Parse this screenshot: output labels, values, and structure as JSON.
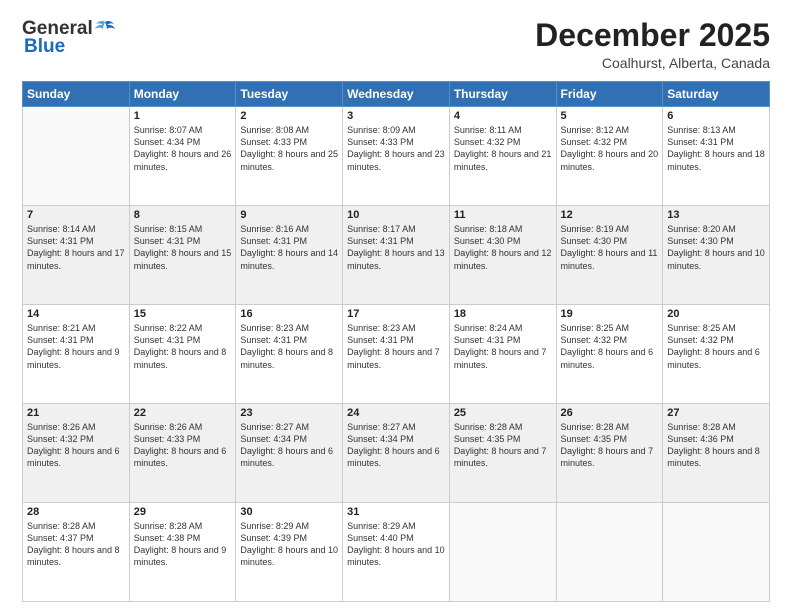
{
  "logo": {
    "general": "General",
    "blue": "Blue"
  },
  "header": {
    "month": "December 2025",
    "location": "Coalhurst, Alberta, Canada"
  },
  "weekdays": [
    "Sunday",
    "Monday",
    "Tuesday",
    "Wednesday",
    "Thursday",
    "Friday",
    "Saturday"
  ],
  "weeks": [
    [
      {
        "day": "",
        "sunrise": "",
        "sunset": "",
        "daylight": ""
      },
      {
        "day": "1",
        "sunrise": "Sunrise: 8:07 AM",
        "sunset": "Sunset: 4:34 PM",
        "daylight": "Daylight: 8 hours and 26 minutes."
      },
      {
        "day": "2",
        "sunrise": "Sunrise: 8:08 AM",
        "sunset": "Sunset: 4:33 PM",
        "daylight": "Daylight: 8 hours and 25 minutes."
      },
      {
        "day": "3",
        "sunrise": "Sunrise: 8:09 AM",
        "sunset": "Sunset: 4:33 PM",
        "daylight": "Daylight: 8 hours and 23 minutes."
      },
      {
        "day": "4",
        "sunrise": "Sunrise: 8:11 AM",
        "sunset": "Sunset: 4:32 PM",
        "daylight": "Daylight: 8 hours and 21 minutes."
      },
      {
        "day": "5",
        "sunrise": "Sunrise: 8:12 AM",
        "sunset": "Sunset: 4:32 PM",
        "daylight": "Daylight: 8 hours and 20 minutes."
      },
      {
        "day": "6",
        "sunrise": "Sunrise: 8:13 AM",
        "sunset": "Sunset: 4:31 PM",
        "daylight": "Daylight: 8 hours and 18 minutes."
      }
    ],
    [
      {
        "day": "7",
        "sunrise": "Sunrise: 8:14 AM",
        "sunset": "Sunset: 4:31 PM",
        "daylight": "Daylight: 8 hours and 17 minutes."
      },
      {
        "day": "8",
        "sunrise": "Sunrise: 8:15 AM",
        "sunset": "Sunset: 4:31 PM",
        "daylight": "Daylight: 8 hours and 15 minutes."
      },
      {
        "day": "9",
        "sunrise": "Sunrise: 8:16 AM",
        "sunset": "Sunset: 4:31 PM",
        "daylight": "Daylight: 8 hours and 14 minutes."
      },
      {
        "day": "10",
        "sunrise": "Sunrise: 8:17 AM",
        "sunset": "Sunset: 4:31 PM",
        "daylight": "Daylight: 8 hours and 13 minutes."
      },
      {
        "day": "11",
        "sunrise": "Sunrise: 8:18 AM",
        "sunset": "Sunset: 4:30 PM",
        "daylight": "Daylight: 8 hours and 12 minutes."
      },
      {
        "day": "12",
        "sunrise": "Sunrise: 8:19 AM",
        "sunset": "Sunset: 4:30 PM",
        "daylight": "Daylight: 8 hours and 11 minutes."
      },
      {
        "day": "13",
        "sunrise": "Sunrise: 8:20 AM",
        "sunset": "Sunset: 4:30 PM",
        "daylight": "Daylight: 8 hours and 10 minutes."
      }
    ],
    [
      {
        "day": "14",
        "sunrise": "Sunrise: 8:21 AM",
        "sunset": "Sunset: 4:31 PM",
        "daylight": "Daylight: 8 hours and 9 minutes."
      },
      {
        "day": "15",
        "sunrise": "Sunrise: 8:22 AM",
        "sunset": "Sunset: 4:31 PM",
        "daylight": "Daylight: 8 hours and 8 minutes."
      },
      {
        "day": "16",
        "sunrise": "Sunrise: 8:23 AM",
        "sunset": "Sunset: 4:31 PM",
        "daylight": "Daylight: 8 hours and 8 minutes."
      },
      {
        "day": "17",
        "sunrise": "Sunrise: 8:23 AM",
        "sunset": "Sunset: 4:31 PM",
        "daylight": "Daylight: 8 hours and 7 minutes."
      },
      {
        "day": "18",
        "sunrise": "Sunrise: 8:24 AM",
        "sunset": "Sunset: 4:31 PM",
        "daylight": "Daylight: 8 hours and 7 minutes."
      },
      {
        "day": "19",
        "sunrise": "Sunrise: 8:25 AM",
        "sunset": "Sunset: 4:32 PM",
        "daylight": "Daylight: 8 hours and 6 minutes."
      },
      {
        "day": "20",
        "sunrise": "Sunrise: 8:25 AM",
        "sunset": "Sunset: 4:32 PM",
        "daylight": "Daylight: 8 hours and 6 minutes."
      }
    ],
    [
      {
        "day": "21",
        "sunrise": "Sunrise: 8:26 AM",
        "sunset": "Sunset: 4:32 PM",
        "daylight": "Daylight: 8 hours and 6 minutes."
      },
      {
        "day": "22",
        "sunrise": "Sunrise: 8:26 AM",
        "sunset": "Sunset: 4:33 PM",
        "daylight": "Daylight: 8 hours and 6 minutes."
      },
      {
        "day": "23",
        "sunrise": "Sunrise: 8:27 AM",
        "sunset": "Sunset: 4:34 PM",
        "daylight": "Daylight: 8 hours and 6 minutes."
      },
      {
        "day": "24",
        "sunrise": "Sunrise: 8:27 AM",
        "sunset": "Sunset: 4:34 PM",
        "daylight": "Daylight: 8 hours and 6 minutes."
      },
      {
        "day": "25",
        "sunrise": "Sunrise: 8:28 AM",
        "sunset": "Sunset: 4:35 PM",
        "daylight": "Daylight: 8 hours and 7 minutes."
      },
      {
        "day": "26",
        "sunrise": "Sunrise: 8:28 AM",
        "sunset": "Sunset: 4:35 PM",
        "daylight": "Daylight: 8 hours and 7 minutes."
      },
      {
        "day": "27",
        "sunrise": "Sunrise: 8:28 AM",
        "sunset": "Sunset: 4:36 PM",
        "daylight": "Daylight: 8 hours and 8 minutes."
      }
    ],
    [
      {
        "day": "28",
        "sunrise": "Sunrise: 8:28 AM",
        "sunset": "Sunset: 4:37 PM",
        "daylight": "Daylight: 8 hours and 8 minutes."
      },
      {
        "day": "29",
        "sunrise": "Sunrise: 8:28 AM",
        "sunset": "Sunset: 4:38 PM",
        "daylight": "Daylight: 8 hours and 9 minutes."
      },
      {
        "day": "30",
        "sunrise": "Sunrise: 8:29 AM",
        "sunset": "Sunset: 4:39 PM",
        "daylight": "Daylight: 8 hours and 10 minutes."
      },
      {
        "day": "31",
        "sunrise": "Sunrise: 8:29 AM",
        "sunset": "Sunset: 4:40 PM",
        "daylight": "Daylight: 8 hours and 10 minutes."
      },
      {
        "day": "",
        "sunrise": "",
        "sunset": "",
        "daylight": ""
      },
      {
        "day": "",
        "sunrise": "",
        "sunset": "",
        "daylight": ""
      },
      {
        "day": "",
        "sunrise": "",
        "sunset": "",
        "daylight": ""
      }
    ]
  ]
}
